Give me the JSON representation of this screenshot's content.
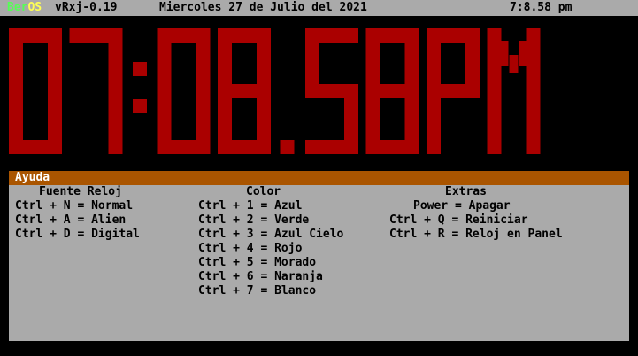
{
  "topbar": {
    "os_name_a": "Ber",
    "os_name_b": "OS",
    "version": "vRxj-0.19",
    "date": "Miercoles 27 de Julio del 2021",
    "time": "7:8.58 pm"
  },
  "clock": {
    "display": "07:08.58PM",
    "color": "#aa0000"
  },
  "help": {
    "title": "Ayuda",
    "columns": [
      {
        "header": "Fuente Reloj",
        "rows": [
          "Ctrl + N = Normal",
          "Ctrl + A = Alien",
          "Ctrl + D = Digital"
        ]
      },
      {
        "header": "Color",
        "rows": [
          "Ctrl + 1 = Azul",
          "Ctrl + 2 = Verde",
          "Ctrl + 3 = Azul Cielo",
          "Ctrl + 4 = Rojo",
          "Ctrl + 5 = Morado",
          "Ctrl + 6 = Naranja",
          "Ctrl + 7 = Blanco"
        ]
      },
      {
        "header": "Extras",
        "rows": [
          "Power = Apagar",
          "Ctrl + Q = Reiniciar",
          "Ctrl + R = Reloj en Panel"
        ]
      }
    ]
  }
}
